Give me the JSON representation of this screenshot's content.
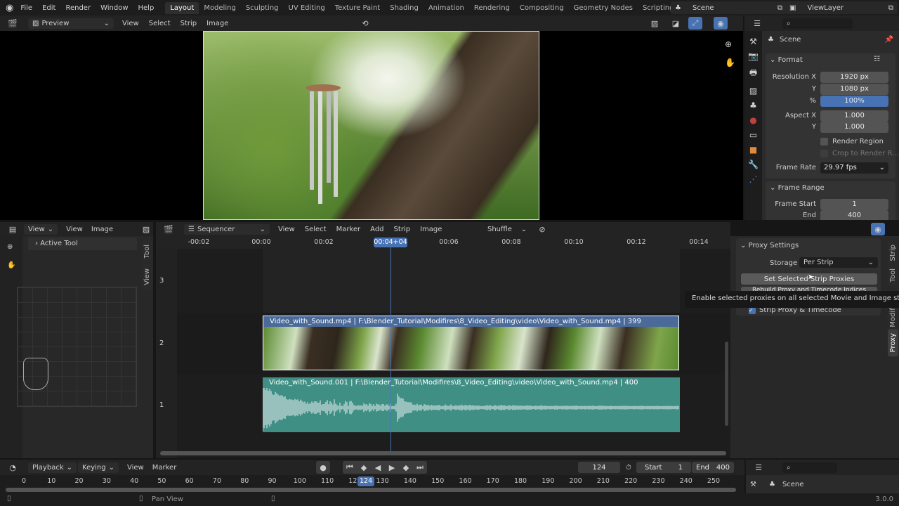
{
  "topbar": {
    "menus": [
      "File",
      "Edit",
      "Render",
      "Window",
      "Help"
    ],
    "workspaces": [
      "Layout",
      "Modeling",
      "Sculpting",
      "UV Editing",
      "Texture Paint",
      "Shading",
      "Animation",
      "Rendering",
      "Compositing",
      "Geometry Nodes",
      "Scripting"
    ],
    "active_workspace": "Layout",
    "add": "+",
    "scene": "Scene",
    "view_layer": "ViewLayer"
  },
  "preview_header": {
    "mode": "Preview",
    "menus": [
      "View",
      "Select",
      "Strip",
      "Image"
    ]
  },
  "properties": {
    "context": "Scene",
    "format": {
      "title": "Format",
      "res_x_label": "Resolution X",
      "res_x": "1920 px",
      "res_y_label": "Y",
      "res_y": "1080 px",
      "pct_label": "%",
      "pct": "100%",
      "aspect_x_label": "Aspect X",
      "aspect_x": "1.000",
      "aspect_y_label": "Y",
      "aspect_y": "1.000",
      "render_region": "Render Region",
      "crop": "Crop to Render R...",
      "frame_rate_label": "Frame Rate",
      "frame_rate": "29.97 fps"
    },
    "frame_range": {
      "title": "Frame Range",
      "start_label": "Frame Start",
      "start": "1",
      "end_label": "End",
      "end": "400"
    }
  },
  "toolbox": {
    "header_menus": [
      "View",
      "View",
      "Image"
    ],
    "active_tool": "Active Tool",
    "side_tab": "Tool",
    "side_tab2": "View"
  },
  "sequencer": {
    "editor": "Sequencer",
    "menus": [
      "View",
      "Select",
      "Marker",
      "Add",
      "Strip",
      "Image"
    ],
    "overlap_mode": "Shuffle",
    "time_labels": [
      "-00:02",
      "00:00",
      "00:02",
      "00:04+04",
      "00:06",
      "00:08",
      "00:10",
      "00:12",
      "00:14"
    ],
    "current_time": "00:04+04",
    "channels": [
      "3",
      "2",
      "1"
    ],
    "video_strip": "Video_with_Sound.mp4 | F:\\Blender_Tutorial\\Modifires\\8_Video_Editing\\video\\Video_with_Sound.mp4 | 399",
    "audio_strip": "Video_with_Sound.001 | F:\\Blender_Tutorial\\Modifires\\8_Video_Editing\\video\\Video_with_Sound.mp4 | 400",
    "playhead_frame": 124,
    "video_color": "#4a6a9a",
    "audio_color": "#3f8f85"
  },
  "sidebar": {
    "panel": "Proxy Settings",
    "storage_label": "Storage",
    "storage": "Per Strip",
    "set_button": "Set Selected Strip Proxies",
    "rebuild_button": "Rebuild Proxy and Timecode Indices",
    "checkbox": "Strip Proxy & Timecode",
    "tooltip": "Enable selected proxies on all selected Movie and Image strips.",
    "tabs": [
      "Strip",
      "Tool",
      "Modifiers",
      "Proxy"
    ]
  },
  "timeline": {
    "menus": [
      "Playback",
      "Keying",
      "View",
      "Marker"
    ],
    "current_frame": "124",
    "start_label": "Start",
    "start": "1",
    "end_label": "End",
    "end": "400",
    "ticks": [
      0,
      10,
      20,
      30,
      40,
      50,
      60,
      70,
      80,
      90,
      100,
      110,
      120,
      130,
      140,
      150,
      160,
      170,
      180,
      190,
      200,
      210,
      220,
      230,
      240,
      250
    ]
  },
  "props_bottom": {
    "context": "Scene"
  },
  "status": {
    "hint": "Pan View",
    "version": "3.0.0"
  },
  "colors": {
    "accent": "#4772b3"
  }
}
